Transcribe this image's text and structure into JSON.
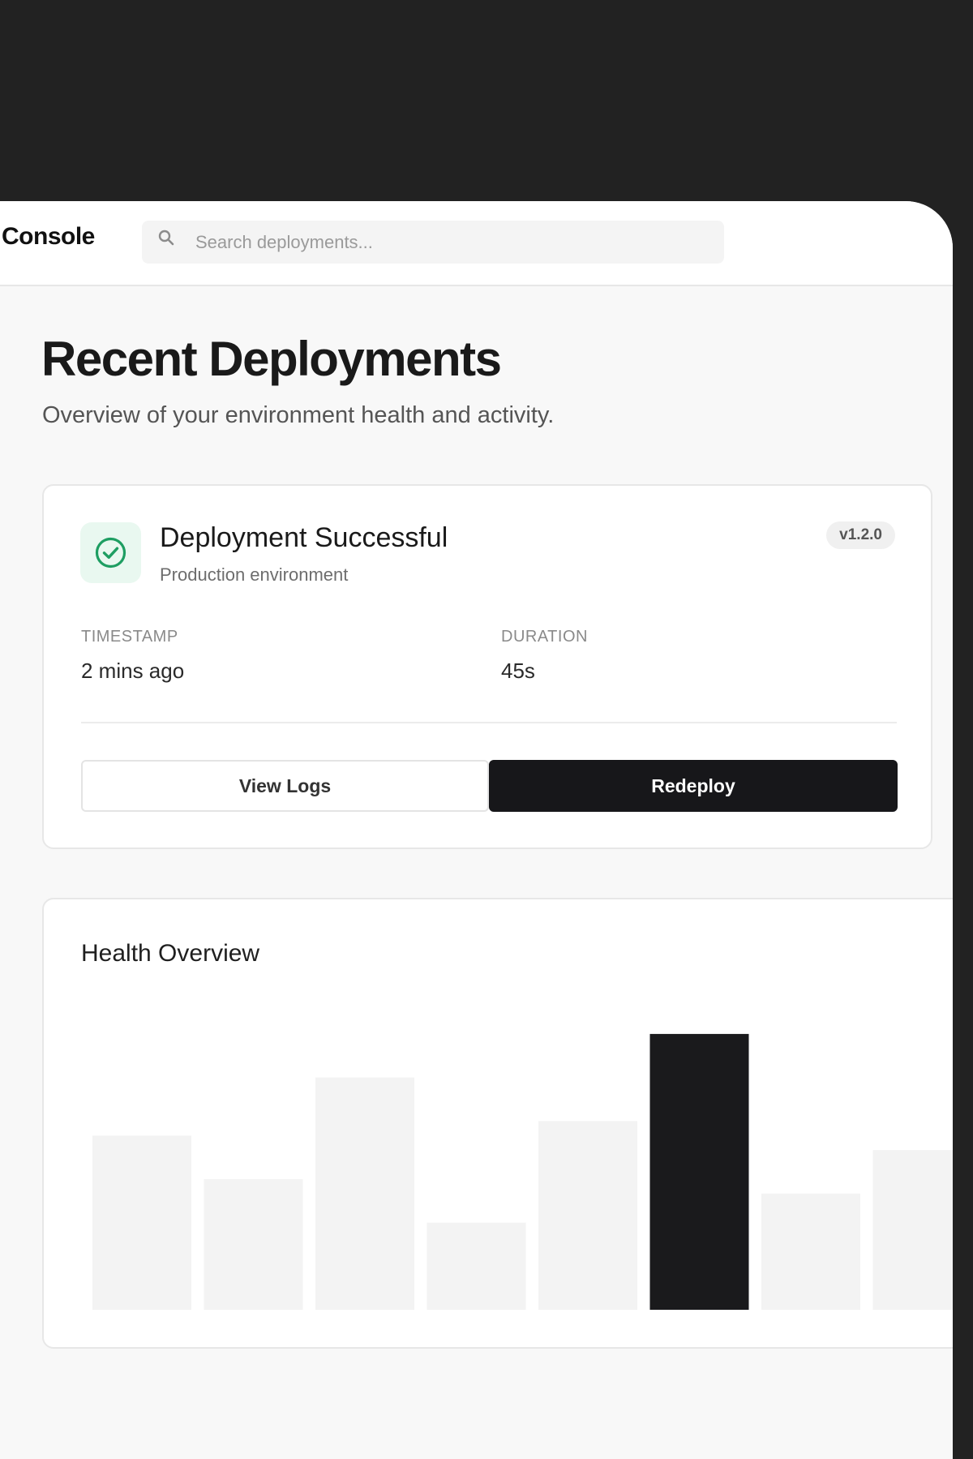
{
  "header": {
    "brand": "Console",
    "search": {
      "placeholder": "Search deployments..."
    }
  },
  "page": {
    "title": "Recent Deployments",
    "subtitle": "Overview of your environment health and activity."
  },
  "deployment_card": {
    "status_icon": "check-circle-icon",
    "title": "Deployment Successful",
    "environment": "Production environment",
    "version": "v1.2.0",
    "timestamp_label": "TIMESTAMP",
    "timestamp_value": "2 mins ago",
    "duration_label": "DURATION",
    "duration_value": "45s",
    "view_logs_label": "View Logs",
    "redeploy_label": "Redeploy"
  },
  "health": {
    "title": "Health Overview"
  },
  "chart_data": {
    "type": "bar",
    "title": "Health Overview",
    "categories": [],
    "values": [
      60,
      45,
      80,
      30,
      65,
      95,
      40,
      55
    ],
    "highlight_index": 5,
    "ylim": [
      0,
      100
    ],
    "grid": false,
    "legend": "none"
  },
  "colors": {
    "accent": "#17171a",
    "success": "#1e9e62",
    "success_bg": "#e9f8f0",
    "bar": "#f3f3f3",
    "bar_highlight": "#1a1a1c"
  }
}
